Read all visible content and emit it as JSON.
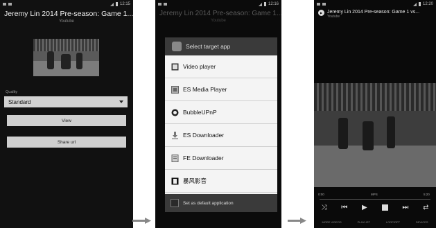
{
  "panel1": {
    "status_time": "12:15",
    "title": "Jeremy Lin 2014 Pre-season: Game 1...",
    "subtitle": "Youtube",
    "quality_label": "Quality",
    "quality_value": "Standard",
    "view_label": "View",
    "share_label": "Share url"
  },
  "panel2": {
    "status_time": "12:16",
    "bg_title": "Jeremy Lin 2014 Pre-season: Game 1...",
    "bg_subtitle": "Youtube",
    "dialog_title": "Select target app",
    "apps": [
      {
        "label": "Video player",
        "icon": "film-icon"
      },
      {
        "label": "ES Media Player",
        "icon": "es-media-icon"
      },
      {
        "label": "BubbleUPnP",
        "icon": "bubble-icon"
      },
      {
        "label": "ES Downloader",
        "icon": "download-icon"
      },
      {
        "label": "FE Downloader",
        "icon": "fe-icon"
      },
      {
        "label": "暴风影音",
        "icon": "storm-player-icon"
      }
    ],
    "default_label": "Set as default application"
  },
  "panel3": {
    "status_time": "12:20",
    "title": "Jeremy Lin 2014 Pre-season: Game 1 vs...",
    "subtitle": "Youtube",
    "time_left": "0:00",
    "time_mid": "MPS",
    "time_right": "5:20",
    "tabs": [
      "MORE VIDEOS",
      "PLAYLIST",
      "LOOP/RPT",
      "DEVICES"
    ]
  },
  "colors": {
    "background": "#0d0d0d",
    "button": "#cfcfcf",
    "dialog": "#f4f4f4",
    "arrow": "#888888"
  }
}
